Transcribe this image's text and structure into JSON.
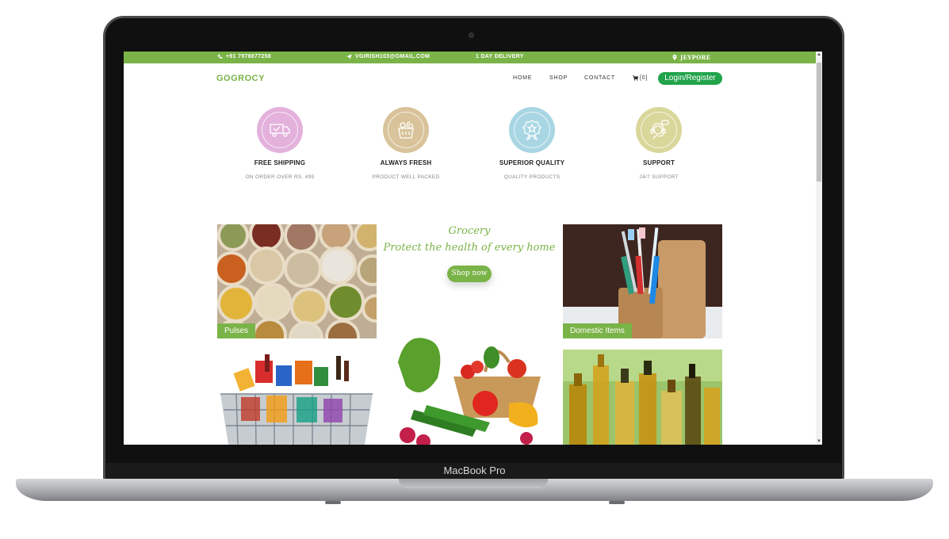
{
  "device": {
    "label": "MacBook Pro"
  },
  "topbar": {
    "phone": "+91 7978877258",
    "email": "VGIRISH103@GMAIL.COM",
    "delivery": "1 DAY DELIVERY",
    "location": "JEYPORE"
  },
  "header": {
    "logo": "GOGROCY",
    "nav": [
      "HOME",
      "SHOP",
      "CONTACT"
    ],
    "cart_count": "[0]",
    "login_label": "Login/Register"
  },
  "features": [
    {
      "title": "FREE SHIPPING",
      "subtitle": "ON ORDER OVER RS. 499",
      "icon": "truck-icon",
      "color": "#e3b1dc"
    },
    {
      "title": "ALWAYS FRESH",
      "subtitle": "PRODUCT WELL PACKED",
      "icon": "grocery-bag-icon",
      "color": "#d9c39a"
    },
    {
      "title": "SUPERIOR QUALITY",
      "subtitle": "QUALITY PRODUCTS",
      "icon": "badge-icon",
      "color": "#a9d6e3"
    },
    {
      "title": "SUPPORT",
      "subtitle": "24/7 SUPPORT",
      "icon": "headset-icon",
      "color": "#d9d79a"
    }
  ],
  "promo": {
    "line1": "Grocery",
    "line2": "Protect the health of every home",
    "button": "Shop now"
  },
  "categories": {
    "pulses": "Pulses",
    "domestic": "Domestic Items"
  },
  "colors": {
    "accent": "#7ab347",
    "login": "#21a34a"
  }
}
